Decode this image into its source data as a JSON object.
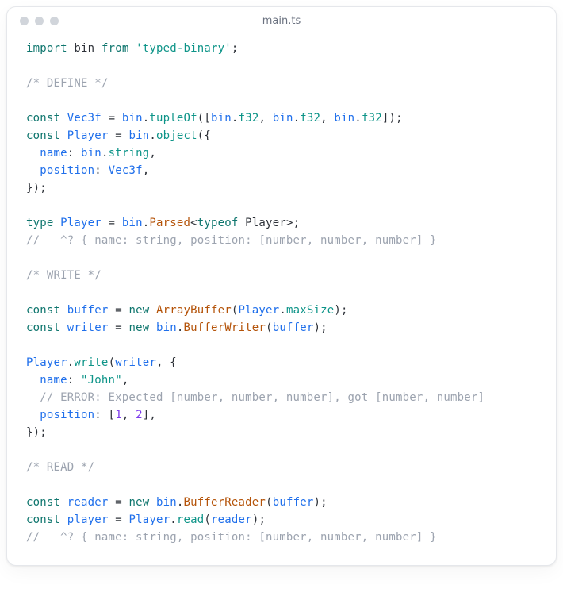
{
  "window": {
    "title": "main.ts"
  },
  "code": {
    "l01_import": "import",
    "l01_bin": " bin ",
    "l01_from": "from",
    "l01_pkg": " 'typed-binary'",
    "l01_semi": ";",
    "l03_cmt": "/* DEFINE */",
    "l05_const": "const",
    "l05_vec": " Vec3f ",
    "l05_eq": "= ",
    "l05_bin": "bin",
    "l05_dot1": ".",
    "l05_tupleOf": "tupleOf",
    "l05_open": "([",
    "l05_bin2": "bin",
    "l05_dot2": ".",
    "l05_f32a": "f32",
    "l05_c1": ", ",
    "l05_bin3": "bin",
    "l05_dot3": ".",
    "l05_f32b": "f32",
    "l05_c2": ", ",
    "l05_bin4": "bin",
    "l05_dot4": ".",
    "l05_f32c": "f32",
    "l05_close": "]);",
    "l06_const": "const",
    "l06_player": " Player ",
    "l06_eq": "= ",
    "l06_bin": "bin",
    "l06_dot": ".",
    "l06_object": "object",
    "l06_open": "({",
    "l07_name": "  name",
    "l07_colon": ": ",
    "l07_bin": "bin",
    "l07_dot": ".",
    "l07_string": "string",
    "l07_c": ",",
    "l08_pos": "  position",
    "l08_colon": ": ",
    "l08_vec": "Vec3f",
    "l08_c": ",",
    "l09_close": "});",
    "l11_type": "type",
    "l11_player": " Player ",
    "l11_eq": "= ",
    "l11_bin": "bin",
    "l11_dot": ".",
    "l11_parsed": "Parsed",
    "l11_lt": "<",
    "l11_typeof": "typeof",
    "l11_player2": " Player",
    "l11_gt": ">;",
    "l12_cmt": "//   ^? { name: string, position: [number, number, number] }",
    "l14_cmt": "/* WRITE */",
    "l16_const": "const",
    "l16_buffer": " buffer ",
    "l16_eq": "= ",
    "l16_new": "new",
    "l16_sp": " ",
    "l16_ab": "ArrayBuffer",
    "l16_open": "(",
    "l16_player": "Player",
    "l16_dot": ".",
    "l16_maxSize": "maxSize",
    "l16_close": ");",
    "l17_const": "const",
    "l17_writer": " writer ",
    "l17_eq": "= ",
    "l17_new": "new",
    "l17_sp": " ",
    "l17_bin": "bin",
    "l17_dot": ".",
    "l17_bw": "BufferWriter",
    "l17_open": "(",
    "l17_buf": "buffer",
    "l17_close": ");",
    "l19_player": "Player",
    "l19_dot": ".",
    "l19_write": "write",
    "l19_open": "(",
    "l19_writer": "writer",
    "l19_c": ", {",
    "l20_name": "  name",
    "l20_colon": ": ",
    "l20_str": "\"John\"",
    "l20_c": ",",
    "l21_cmt": "  // ERROR: Expected [number, number, number], got [number, number]",
    "l22_pos": "  position",
    "l22_colon": ": [",
    "l22_n1": "1",
    "l22_c1": ", ",
    "l22_n2": "2",
    "l22_close": "],",
    "l23_close": "});",
    "l25_cmt": "/* READ */",
    "l27_const": "const",
    "l27_reader": " reader ",
    "l27_eq": "= ",
    "l27_new": "new",
    "l27_sp": " ",
    "l27_bin": "bin",
    "l27_dot": ".",
    "l27_br": "BufferReader",
    "l27_open": "(",
    "l27_buf": "buffer",
    "l27_close": ");",
    "l28_const": "const",
    "l28_player": " player ",
    "l28_eq": "= ",
    "l28_Player": "Player",
    "l28_dot": ".",
    "l28_read": "read",
    "l28_open": "(",
    "l28_reader": "reader",
    "l28_close": ");",
    "l29_cmt": "//   ^? { name: string, position: [number, number, number] }"
  }
}
